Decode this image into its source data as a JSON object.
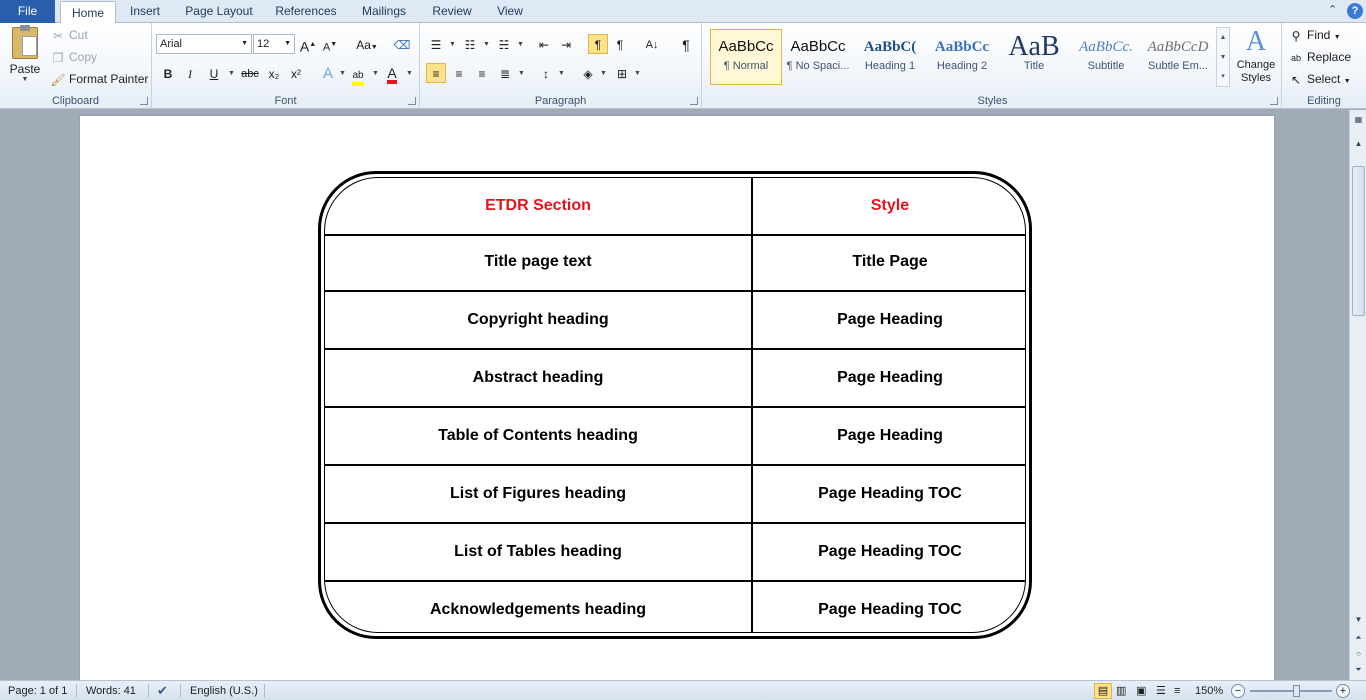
{
  "tabs": [
    "File",
    "Home",
    "Insert",
    "Page Layout",
    "References",
    "Mailings",
    "Review",
    "View"
  ],
  "clipboard": {
    "paste": "Paste",
    "cut": "Cut",
    "copy": "Copy",
    "format_painter": "Format Painter",
    "label": "Clipboard"
  },
  "font": {
    "name": "Arial",
    "size": "12",
    "label": "Font",
    "bold": "B",
    "italic": "I",
    "underline": "U",
    "strike": "abc",
    "subscript": "x₂",
    "superscript": "x²",
    "grow": "A",
    "shrink": "A",
    "case": "Aa"
  },
  "paragraph": {
    "label": "Paragraph"
  },
  "styles": {
    "label": "Styles",
    "items": [
      {
        "sample": "AaBbCc",
        "name": "¶ Normal"
      },
      {
        "sample": "AaBbCc",
        "name": "¶ No Spaci..."
      },
      {
        "sample": "AaBbC(",
        "name": "Heading 1"
      },
      {
        "sample": "AaBbCc",
        "name": "Heading 2"
      },
      {
        "sample": "AaB",
        "name": "Title"
      },
      {
        "sample": "AaBbCc.",
        "name": "Subtitle"
      },
      {
        "sample": "AaBbCcD",
        "name": "Subtle Em..."
      }
    ],
    "change_styles": "Change Styles"
  },
  "editing": {
    "label": "Editing",
    "find": "Find",
    "replace": "Replace",
    "select": "Select"
  },
  "table": {
    "headers": [
      "ETDR Section",
      "Style"
    ],
    "rows": [
      [
        "Title page text",
        "Title Page"
      ],
      [
        "Copyright heading",
        "Page Heading"
      ],
      [
        "Abstract heading",
        "Page Heading"
      ],
      [
        "Table of Contents heading",
        "Page Heading"
      ],
      [
        "List of Figures heading",
        "Page Heading TOC"
      ],
      [
        "List of Tables heading",
        "Page Heading TOC"
      ],
      [
        "Acknowledgements heading",
        "Page Heading TOC"
      ]
    ],
    "header_color": "#e0161c"
  },
  "status": {
    "page": "Page: 1 of 1",
    "words": "Words: 41",
    "language": "English (U.S.)",
    "zoom": "150%"
  },
  "colors": {
    "file_tab": "#2a5fad",
    "highlight_button": "#ffe38a"
  }
}
